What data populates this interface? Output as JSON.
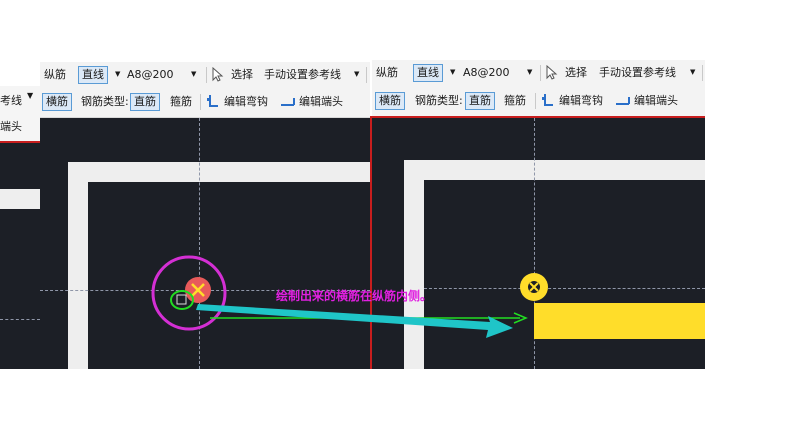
{
  "left_panel": {
    "ref_line_fragment": "考线",
    "end_fragment": "端头"
  },
  "mid_panel": {
    "row1": {
      "longitudinal": "纵筋",
      "line_mode": "直线",
      "spec": "A8@200",
      "select": "选择",
      "manual_ref": "手动设置参考线"
    },
    "row2": {
      "transverse": "横筋",
      "rebar_type_label": "钢筋类型:",
      "rebar_type_value": "直筋",
      "stirrup": "箍筋",
      "edit_bend": "编辑弯钩",
      "edit_end": "编辑端头"
    }
  },
  "right_panel": {
    "row1": {
      "longitudinal": "纵筋",
      "line_mode": "直线",
      "spec": "A8@200",
      "select": "选择",
      "manual_ref": "手动设置参考线"
    },
    "row2": {
      "transverse": "横筋",
      "rebar_type_label": "钢筋类型:",
      "rebar_type_value": "直筋",
      "stirrup": "箍筋",
      "edit_bend": "编辑弯钩",
      "edit_end": "编辑端头"
    }
  },
  "annotation": {
    "text": "绘制出来的横筋在纵筋内侧。",
    "color": "#e020e0"
  },
  "colors": {
    "canvas": "#1c1f26",
    "slab_border": "#eeeeee",
    "rebar": "#ffdd2a",
    "highlight_ring": "#d42fd4",
    "arrow": "#1fc5c8",
    "green_arrow": "#22dd22"
  }
}
